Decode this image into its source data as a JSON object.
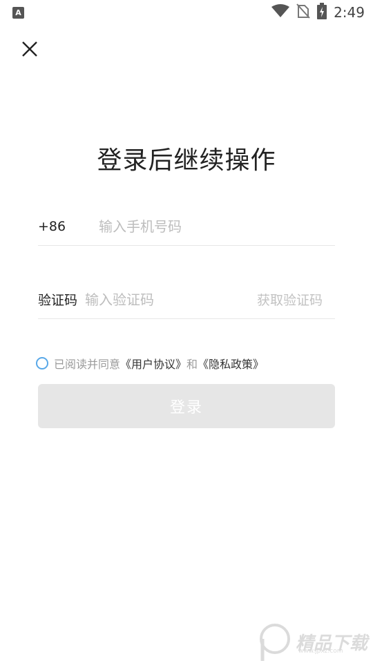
{
  "status_bar": {
    "app_badge": "A",
    "time": "2:49",
    "icons": [
      "wifi-icon",
      "no-sim-icon",
      "battery-charging-icon"
    ]
  },
  "header": {
    "close_icon": "close-icon",
    "title": "登录后继续操作"
  },
  "phone_field": {
    "prefix": "+86",
    "placeholder": "输入手机号码",
    "value": ""
  },
  "code_field": {
    "label": "验证码",
    "placeholder": "输入验证码",
    "value": "",
    "get_code_label": "获取验证码"
  },
  "agreement": {
    "prefix": "已阅读并同意",
    "user_agreement": "《用户协议》",
    "conjunction": "和",
    "privacy_policy": "《隐私政策》",
    "checked": false
  },
  "login_button": {
    "label": "登录",
    "enabled": false
  },
  "watermark": {
    "text": "精品下载",
    "sub": "www.jpxz.com"
  },
  "colors": {
    "radio_border": "#58a8e8",
    "button_disabled_bg": "#e6e6e6",
    "placeholder": "#bdbdbd"
  }
}
